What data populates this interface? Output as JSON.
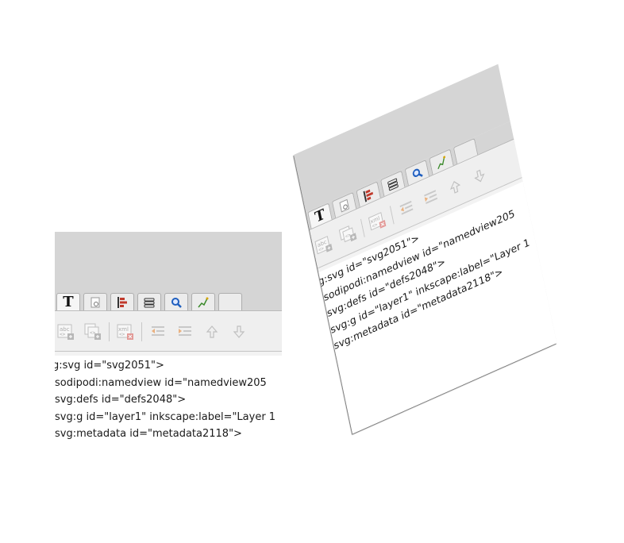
{
  "xml_editor": {
    "tabs": [
      {
        "icon": "text-icon",
        "label": "T"
      },
      {
        "icon": "xml-doc-icon"
      },
      {
        "icon": "align-icon"
      },
      {
        "icon": "layers-icon"
      },
      {
        "icon": "find-icon"
      },
      {
        "icon": "pen-icon"
      }
    ],
    "toolbar": [
      {
        "icon": "new-element-node-icon",
        "label": "abc"
      },
      {
        "icon": "new-text-node-icon"
      },
      {
        "icon": "delete-node-icon",
        "label": "xml"
      },
      {
        "icon": "unindent-node-icon"
      },
      {
        "icon": "indent-node-icon"
      },
      {
        "icon": "raise-node-icon"
      },
      {
        "icon": "lower-node-icon"
      }
    ],
    "nodes": [
      "g:svg id=\"svg2051\">",
      "sodipodi:namedview id=\"namedview205",
      "svg:defs id=\"defs2048\">",
      "svg:g id=\"layer1\" inkscape:label=\"Layer 1",
      "svg:metadata id=\"metadata2118\">"
    ]
  },
  "colors": {
    "chrome": "#d5d5d5",
    "panel_background": "#ffffff",
    "align_icon_red": "#c0392b",
    "find_icon_blue": "#1f5fbf",
    "pen_icon_green": "#3a8a2a"
  }
}
